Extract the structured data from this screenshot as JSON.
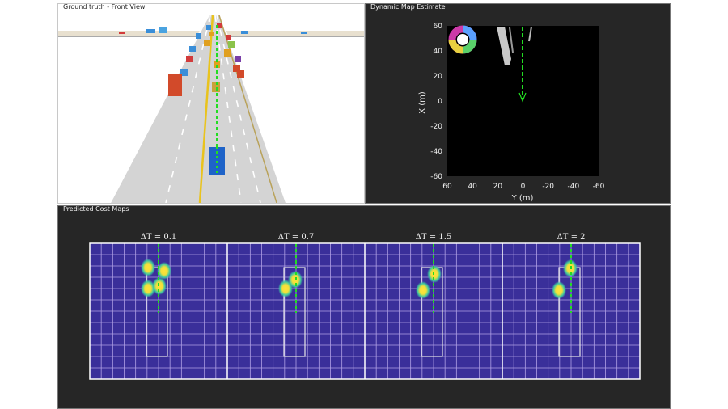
{
  "panels": {
    "ground_truth": {
      "title": "Ground truth - Front View"
    },
    "dynamic_map": {
      "title": "Dynamic Map Estimate"
    },
    "cost_maps": {
      "title": "Predicted Cost Maps"
    }
  },
  "dynamic_map": {
    "x_axis_label": "X (m)",
    "y_axis_label": "Y (m)",
    "x_ticks": [
      "60",
      "40",
      "20",
      "0",
      "-20",
      "-40",
      "-60"
    ],
    "y_ticks": [
      "60",
      "40",
      "20",
      "0",
      "-20",
      "-40",
      "-60"
    ],
    "plot_background": "#000000",
    "path_color": "#22dd22"
  },
  "cost_maps": {
    "subplots": [
      {
        "label": "ΔT = 0.1"
      },
      {
        "label": "ΔT = 0.7"
      },
      {
        "label": "ΔT = 1.5"
      },
      {
        "label": "ΔT = 2"
      }
    ],
    "background_color": "#3a2f9a",
    "grid_color": "#d7c6ff",
    "hotspot_color": "#ffe23a"
  },
  "colors": {
    "ego_vehicle": "#1e63c8",
    "lane_marking_center": "#e9c31d",
    "predicted_path": "#22dd22"
  }
}
